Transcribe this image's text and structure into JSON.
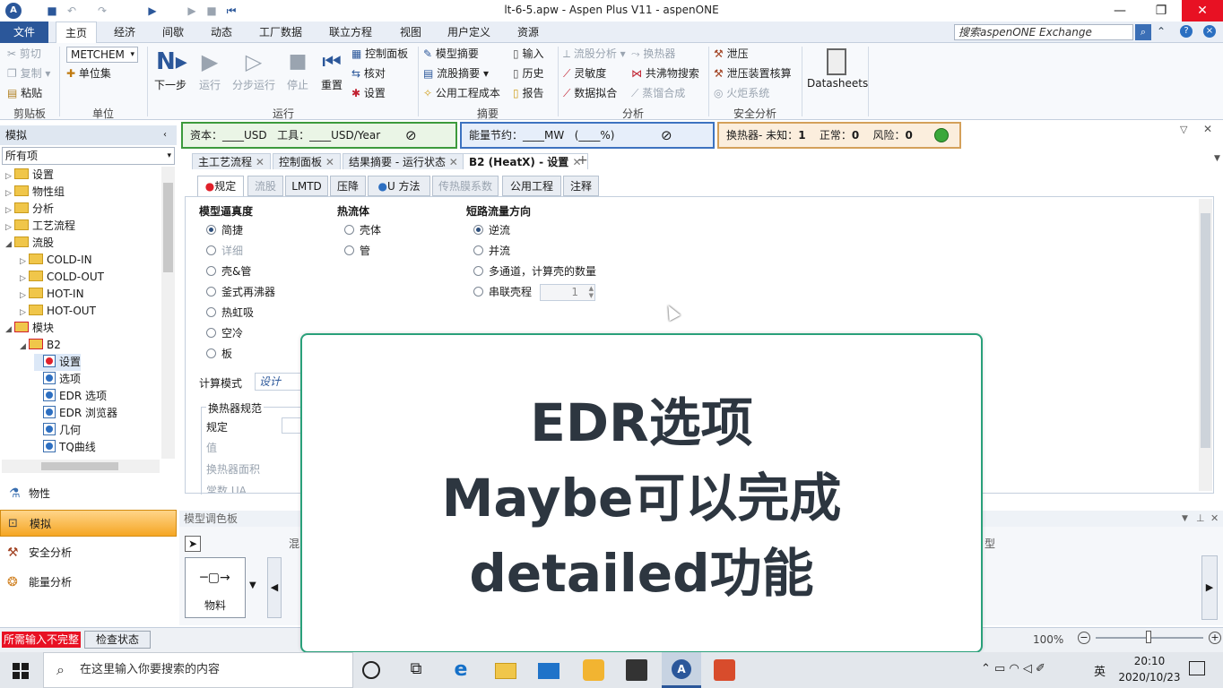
{
  "window": {
    "title": "lt-6-5.apw - Aspen Plus V11 - aspenONE",
    "minimize": "—",
    "restore": "❐",
    "close": "✕"
  },
  "menu": {
    "file": "文件",
    "tabs": [
      "主页",
      "经济",
      "间歇",
      "动态",
      "工厂数据",
      "联立方程",
      "视图",
      "用户定义",
      "资源"
    ],
    "search_placeholder": "搜索aspenONE Exchange"
  },
  "ribbon": {
    "clipboard": {
      "cut": "剪切",
      "copy": "复制",
      "paste": "粘贴",
      "group": "剪贴板"
    },
    "units": {
      "set_value": "METCHEM",
      "unit_set": "单位集",
      "group": "单位"
    },
    "run": {
      "next": "下一步",
      "run": "运行",
      "step": "分步运行",
      "stop": "停止",
      "reset": "重置",
      "control_panel": "控制面板",
      "check": "核对",
      "settings": "设置",
      "group": "运行"
    },
    "summary": {
      "model_summary": "模型摘要",
      "stream_summary": "流股摘要",
      "utility_cost": "公用工程成本",
      "input": "输入",
      "history": "历史",
      "report": "报告",
      "group": "摘要"
    },
    "analysis": {
      "stream_analysis": "流股分析",
      "heat_exchanger": "换热器",
      "sensitivity": "灵敏度",
      "azeotrope": "共沸物搜索",
      "data_fit": "数据拟合",
      "distillation_synthesis": "蒸馏合成",
      "group": "分析"
    },
    "safety": {
      "relief": "泄压",
      "relief_device": "泄压装置核算",
      "flare": "火炬系统",
      "group": "安全分析"
    },
    "datasheets": "Datasheets"
  },
  "strips": {
    "cost": {
      "capital": "资本：",
      "capital_unit": "USD",
      "utility": "工具：",
      "utility_unit": "USD/Year",
      "blank": "____"
    },
    "energy": {
      "label": "能量节约：",
      "unit": "MW",
      "pct": "(____%)",
      "blank": "____"
    },
    "hx": {
      "label": "换热器-",
      "unknown": "未知：",
      "unknown_val": "1",
      "normal": "正常：",
      "normal_val": "0",
      "risk": "风险：",
      "risk_val": "0"
    }
  },
  "nav": {
    "header": "模拟",
    "filter": "所有项",
    "tree": [
      {
        "label": "设置",
        "level": 1,
        "icon": "folder-ok"
      },
      {
        "label": "物性组",
        "level": 1,
        "icon": "folder-ok"
      },
      {
        "label": "分析",
        "level": 1,
        "icon": "folder"
      },
      {
        "label": "工艺流程",
        "level": 1,
        "icon": "folder-ok"
      },
      {
        "label": "流股",
        "level": 1,
        "icon": "folder-ok"
      },
      {
        "label": "COLD-IN",
        "level": 2,
        "icon": "folder-ok"
      },
      {
        "label": "COLD-OUT",
        "level": 2,
        "icon": "folder-ok"
      },
      {
        "label": "HOT-IN",
        "level": 2,
        "icon": "folder-ok"
      },
      {
        "label": "HOT-OUT",
        "level": 2,
        "icon": "folder-ok"
      },
      {
        "label": "模块",
        "level": 1,
        "icon": "folder-bad"
      },
      {
        "label": "B2",
        "level": 2,
        "icon": "folder-bad"
      },
      {
        "label": "设置",
        "level": 3,
        "icon": "leaf-bad"
      },
      {
        "label": "选项",
        "level": 3,
        "icon": "leaf-ok"
      },
      {
        "label": "EDR 选项",
        "level": 3,
        "icon": "leaf-ok"
      },
      {
        "label": "EDR 浏览器",
        "level": 3,
        "icon": "leaf-ok"
      },
      {
        "label": "几何",
        "level": 3,
        "icon": "leaf-ok"
      },
      {
        "label": "TQ曲线",
        "level": 3,
        "icon": "leaf-ok"
      }
    ],
    "buttons": [
      "物性",
      "模拟",
      "安全分析",
      "能量分析"
    ]
  },
  "doc_tabs": [
    "主工艺流程",
    "控制面板",
    "结果摘要 - 运行状态",
    "B2 (HeatX) - 设置"
  ],
  "form": {
    "tabs": [
      "规定",
      "流股",
      "LMTD",
      "压降",
      "U 方法",
      "传热膜系数",
      "公用工程",
      "注释"
    ],
    "fidelity_title": "模型逼真度",
    "fidelity_options": [
      "简捷",
      "详细",
      "壳&管",
      "釜式再沸器",
      "热虹吸",
      "空冷",
      "板"
    ],
    "hot_fluid_title": "热流体",
    "hot_fluid_options": [
      "壳体",
      "管"
    ],
    "flow_dir_title": "短路流量方向",
    "flow_dir_options": [
      "逆流",
      "并流",
      "多通道，计算壳的数量",
      "串联壳程"
    ],
    "series_shells": "1",
    "calc_mode_label": "计算模式",
    "calc_mode_value": "设计",
    "hx_spec_title": "换热器规范",
    "hx_spec_rows": [
      "规定",
      "值",
      "换热器面积",
      "常数 UA"
    ]
  },
  "palette": {
    "header": "模型调色板",
    "tabs_partial": [
      "混",
      "型"
    ],
    "material": "物料"
  },
  "status": {
    "required_input": "所需输入不完整",
    "check_status": "检查状态",
    "zoom": "100%"
  },
  "overlay": {
    "line1": "EDR选项",
    "line2": "Maybe可以完成",
    "line3": "detailed功能"
  },
  "taskbar": {
    "search_placeholder": "在这里输入你要搜索的内容",
    "time": "20:10",
    "date": "2020/10/23",
    "ime": "英"
  }
}
